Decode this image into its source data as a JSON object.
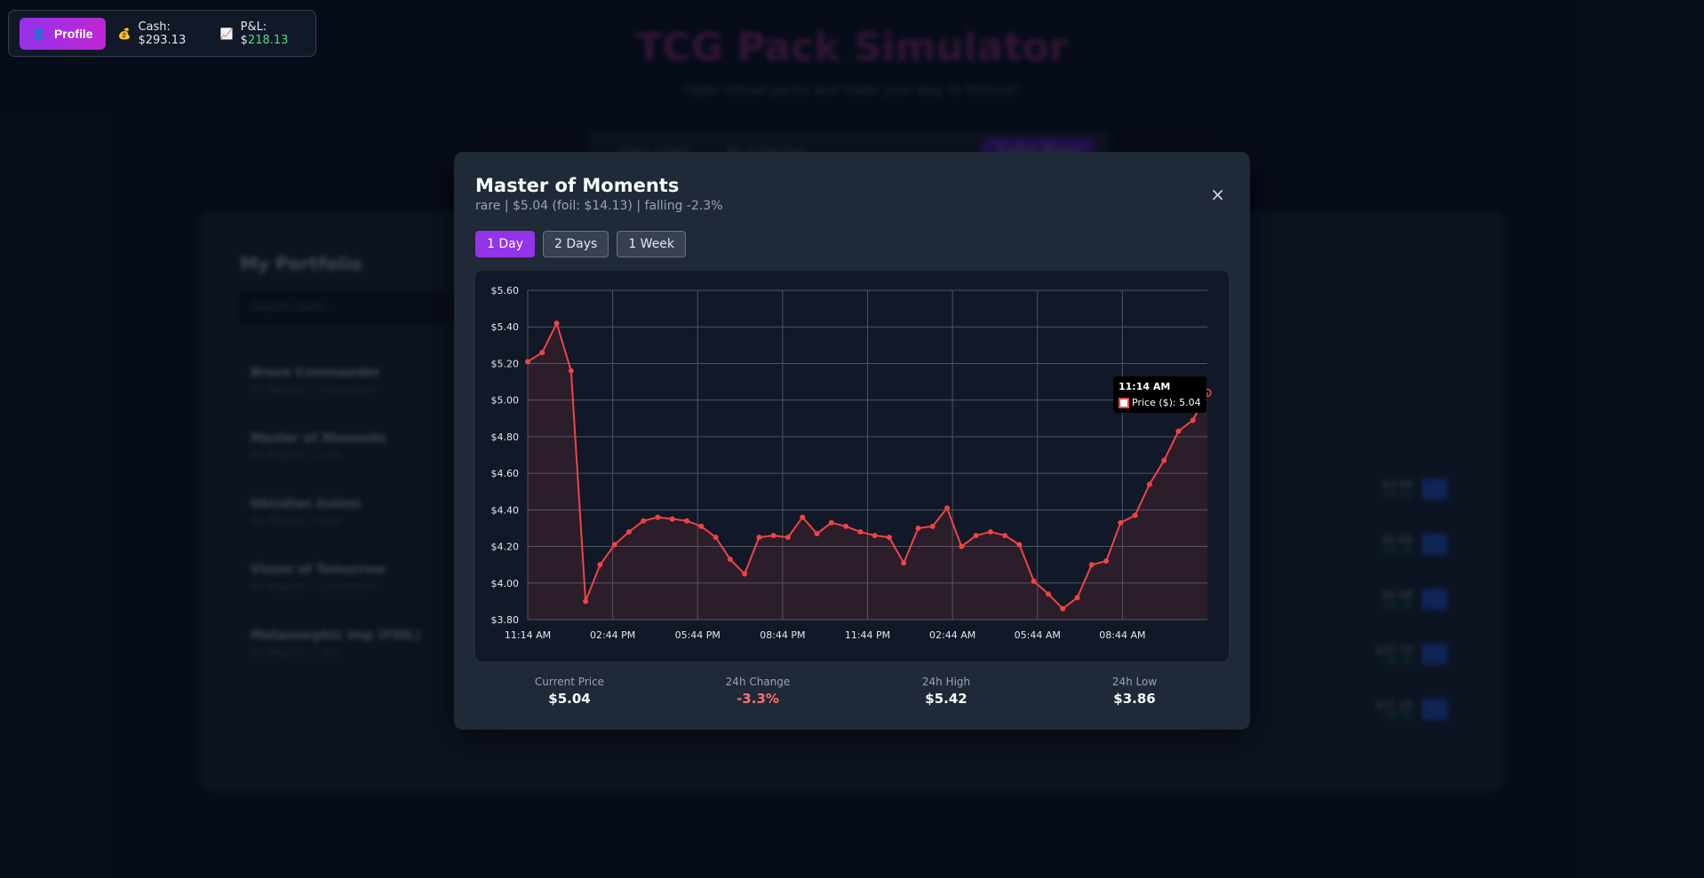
{
  "background": {
    "title": "TCG Pack Simulator",
    "subtitle": "Open virtual packs and trade your way to fortune!",
    "tabs": [
      "Open a Pack",
      "My Collection",
      "Trading Market"
    ],
    "portfolio_title": "My Portfolio",
    "search_placeholder": "Search cards...",
    "items": [
      {
        "name": "Brave Commander",
        "sub": "#1 Regular, 1 uncommon"
      },
      {
        "name": "Master of Moments",
        "sub": "#1 Regular, 1 rare"
      },
      {
        "name": "Obsidian Golem",
        "sub": "#1 Regular, 1 rare"
      },
      {
        "name": "Vision of Tomorrow",
        "sub": "#1 Regular, 1 uncommon"
      },
      {
        "name": "Metamorphic Imp (FOIL)",
        "sub": "#1 Regular, 1 rare"
      }
    ],
    "right_prices": [
      {
        "price": "$3.04",
        "change": "+$0.00"
      },
      {
        "price": "$5.60",
        "change": "+$0.00"
      },
      {
        "price": "$4.08",
        "change": "+$0.00"
      },
      {
        "price": "$15.70",
        "change": "+$0.00"
      },
      {
        "price": "$11.20",
        "change": "+$0.00"
      }
    ]
  },
  "statusbar": {
    "profile_label": "Profile",
    "profile_icon": "person-icon",
    "cash_label": "Cash: $293.13",
    "cash_icon": "money-bag-icon",
    "pl_label": "P&L: $",
    "pl_value": "218.13",
    "pl_icon": "chart-icon",
    "pl_color": "#4ade80"
  },
  "modal": {
    "title": "Master of Moments",
    "subtitle": "rare | $5.04 (foil: $14.13) | falling -2.3%",
    "close_label": "×",
    "ranges": [
      "1 Day",
      "2 Days",
      "1 Week"
    ],
    "active_range": "1 Day",
    "tooltip": {
      "title": "11:14 AM",
      "row": "Price ($): 5.04"
    },
    "stats": [
      {
        "label": "Current Price",
        "value": "$5.04"
      },
      {
        "label": "24h Change",
        "value": "-3.3%"
      },
      {
        "label": "24h High",
        "value": "$5.42"
      },
      {
        "label": "24h Low",
        "value": "$3.86"
      }
    ]
  },
  "chart_data": {
    "type": "area",
    "series": [
      {
        "name": "Price ($)",
        "color": "#ef4444",
        "values": [
          5.21,
          5.26,
          5.42,
          5.16,
          3.9,
          4.1,
          4.21,
          4.28,
          4.34,
          4.36,
          4.35,
          4.34,
          4.31,
          4.25,
          4.13,
          4.05,
          4.25,
          4.26,
          4.25,
          4.36,
          4.27,
          4.33,
          4.31,
          4.28,
          4.26,
          4.25,
          4.11,
          4.3,
          4.31,
          4.41,
          4.2,
          4.26,
          4.28,
          4.26,
          4.21,
          4.01,
          3.94,
          3.86,
          3.92,
          4.1,
          4.12,
          4.33,
          4.37,
          4.54,
          4.67,
          4.83,
          4.89,
          5.04
        ]
      }
    ],
    "x_tick_labels": [
      "11:14 AM",
      "02:44 PM",
      "05:44 PM",
      "08:44 PM",
      "11:44 PM",
      "02:44 AM",
      "05:44 AM",
      "08:44 AM"
    ],
    "y_tick_labels": [
      "$5.60",
      "$5.40",
      "$5.20",
      "$5.00",
      "$4.80",
      "$4.60",
      "$4.40",
      "$4.20",
      "$4.00",
      "$3.80"
    ],
    "ylim": [
      3.8,
      5.6
    ],
    "grid": true
  }
}
